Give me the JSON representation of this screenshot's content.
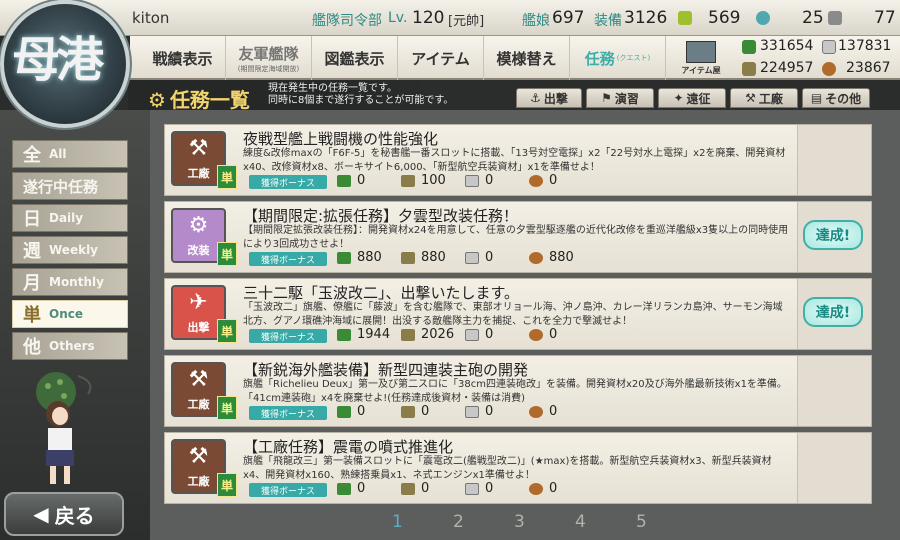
{
  "header": {
    "username": "kiton",
    "hq_label": "艦隊司令部",
    "lv_label": "Lv.",
    "level": "120",
    "rank": "[元帥]",
    "ship_label": "艦娘",
    "ship_count": "697",
    "equip_label": "装備",
    "equip_count": "3126",
    "bucket": "569",
    "dev_mat": "25",
    "screw": "77"
  },
  "logo_text": "母港",
  "menu": {
    "items": [
      {
        "label": "戦績表示"
      },
      {
        "label": "友軍艦隊",
        "sub": "(期間限定海域開放)"
      },
      {
        "label": "図鑑表示"
      },
      {
        "label": "アイテム"
      },
      {
        "label": "模様替え"
      },
      {
        "label": "任務",
        "sub": "(クエスト)"
      }
    ],
    "shop_label": "アイテム屋"
  },
  "resources": {
    "fuel": "331654",
    "steel": "137831",
    "ammo": "224957",
    "bauxite": "23867"
  },
  "page": {
    "title": "任務一覧",
    "desc_line1": "現在発生中の任務一覧です。",
    "desc_line2": "同時に8個まで遂行することが可能です。"
  },
  "filter_tabs": [
    "出撃",
    "演習",
    "遠征",
    "工廠",
    "その他"
  ],
  "sidebar": {
    "items": [
      {
        "big": "全",
        "sm": "All"
      },
      {
        "big": "遂行中任務",
        "sm": ""
      },
      {
        "big": "日",
        "sm": "Daily"
      },
      {
        "big": "週",
        "sm": "Weekly"
      },
      {
        "big": "月",
        "sm": "Monthly"
      },
      {
        "big": "単",
        "sm": "Once"
      },
      {
        "big": "他",
        "sm": "Others"
      }
    ],
    "back_label": "戻る"
  },
  "bonus_label": "獲得ボーナス",
  "freq_badge": "単",
  "quests": [
    {
      "category": "工廠",
      "title": "夜戦型艦上戦闘機の性能強化",
      "desc": "練度&改修maxの「F6F-5」を秘書艦一番スロットに搭載、「13号対空電探」x2「22号対水上電探」x2を廃棄、開発資材x40、改修資材x8、ボーキサイト6,000、「新型航空兵装資材」x1を準備せよ！",
      "fuel": "0",
      "ammo": "100",
      "steel": "0",
      "baux": "0",
      "status": ""
    },
    {
      "category": "改装",
      "title": "【期間限定:拡張任務】夕雲型改装任務！",
      "desc": "【期間限定拡張改装任務】：開発資材x24を用意して、任意の夕雲型駆逐艦の近代化改修を重巡洋艦級x3隻以上の同時使用により3回成功させよ！",
      "fuel": "880",
      "ammo": "880",
      "steel": "0",
      "baux": "880",
      "status": "達成!"
    },
    {
      "category": "出撃",
      "title": "三十二駆「玉波改二」、出撃いたします。",
      "desc": "「玉波改二」旗艦、僚艦に「藤波」を含む艦隊で、東部オリョール海、沖ノ島沖、カレー洋リランカ島沖、サーモン海域北方、グアノ環礁沖海域に展開！出没する敵艦隊主力を捕捉、これを全力で撃滅せよ！",
      "fuel": "1944",
      "ammo": "2026",
      "steel": "0",
      "baux": "0",
      "status": "達成!"
    },
    {
      "category": "工廠",
      "title": "【新鋭海外艦装備】新型四連装主砲の開発",
      "desc": "旗艦「Richelieu Deux」第一及び第二スロに「38cm四連装砲改」を装備。開発資材x20及び海外艦最新技術x1を準備。「41cm連装砲」x4を廃棄せよ!(任務達成後資材・装備は消費)",
      "fuel": "0",
      "ammo": "0",
      "steel": "0",
      "baux": "0",
      "status": ""
    },
    {
      "category": "工廠",
      "title": "【工廠任務】震電の噴式推進化",
      "desc": "旗艦「飛龍改三」第一装備スロットに「震電改二(艦戦型改二)」(★max)を搭載。新型航空兵装資材x3、新型兵装資材x4、開発資材x160、熟練搭乗員x1、ネ式エンジンx1準備せよ！",
      "fuel": "0",
      "ammo": "0",
      "steel": "0",
      "baux": "0",
      "status": ""
    }
  ],
  "pager": [
    "1",
    "2",
    "3",
    "4",
    "5"
  ],
  "colors": {
    "accent": "#37a9a6",
    "factory_icon": "#7a4a34",
    "remodel_icon": "#b48acb",
    "sortie_icon": "#d9534a"
  }
}
